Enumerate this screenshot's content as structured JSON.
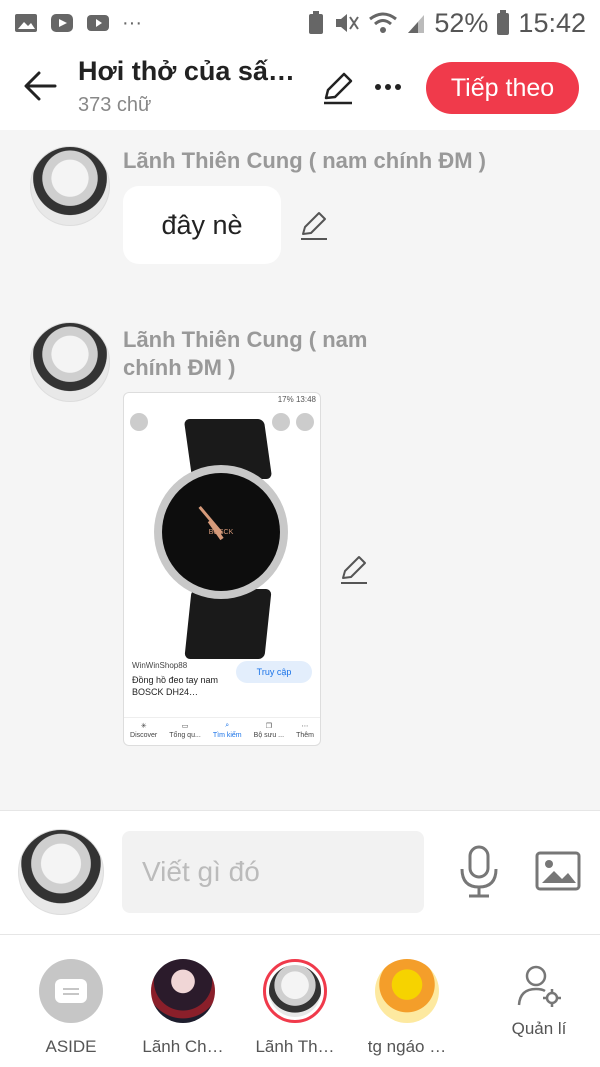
{
  "status_bar": {
    "battery": "52%",
    "time": "15:42",
    "dots": "···"
  },
  "header": {
    "title": "Hơi thở của sấ…",
    "word_count": "373 chữ",
    "next_label": "Tiếp theo"
  },
  "messages": [
    {
      "author": "Lãnh Thiên Cung ( nam chính ĐM )",
      "text": "đây nè"
    },
    {
      "author": "Lãnh Thiên Cung ( nam chính ĐM )",
      "image": {
        "status": "17% 13:48",
        "brand": "BOSCK",
        "shop": "WinWinShop88",
        "product": "Đồng hồ đeo tay nam BOSCK DH24…",
        "visit_label": "Truy cập",
        "nav": [
          {
            "label": "Discover"
          },
          {
            "label": "Tổng qu..."
          },
          {
            "label": "Tìm kiếm"
          },
          {
            "label": "Bộ sưu ..."
          },
          {
            "label": "Thêm"
          }
        ]
      }
    }
  ],
  "input": {
    "placeholder": "Viết gì đó"
  },
  "characters": [
    {
      "label": "ASIDE"
    },
    {
      "label": "Lãnh Ch…"
    },
    {
      "label": "Lãnh Th…"
    },
    {
      "label": "tg ngáo …"
    },
    {
      "label": "Quản lí"
    }
  ],
  "colors": {
    "accent": "#f03a4b",
    "background": "#f5f5f5",
    "name_gray": "#999999"
  },
  "icons": {
    "back": "arrow-left-icon",
    "edit": "pencil-icon",
    "more": "more-horizontal-icon",
    "mic": "microphone-icon",
    "image": "image-icon",
    "manage": "user-gear-icon"
  }
}
